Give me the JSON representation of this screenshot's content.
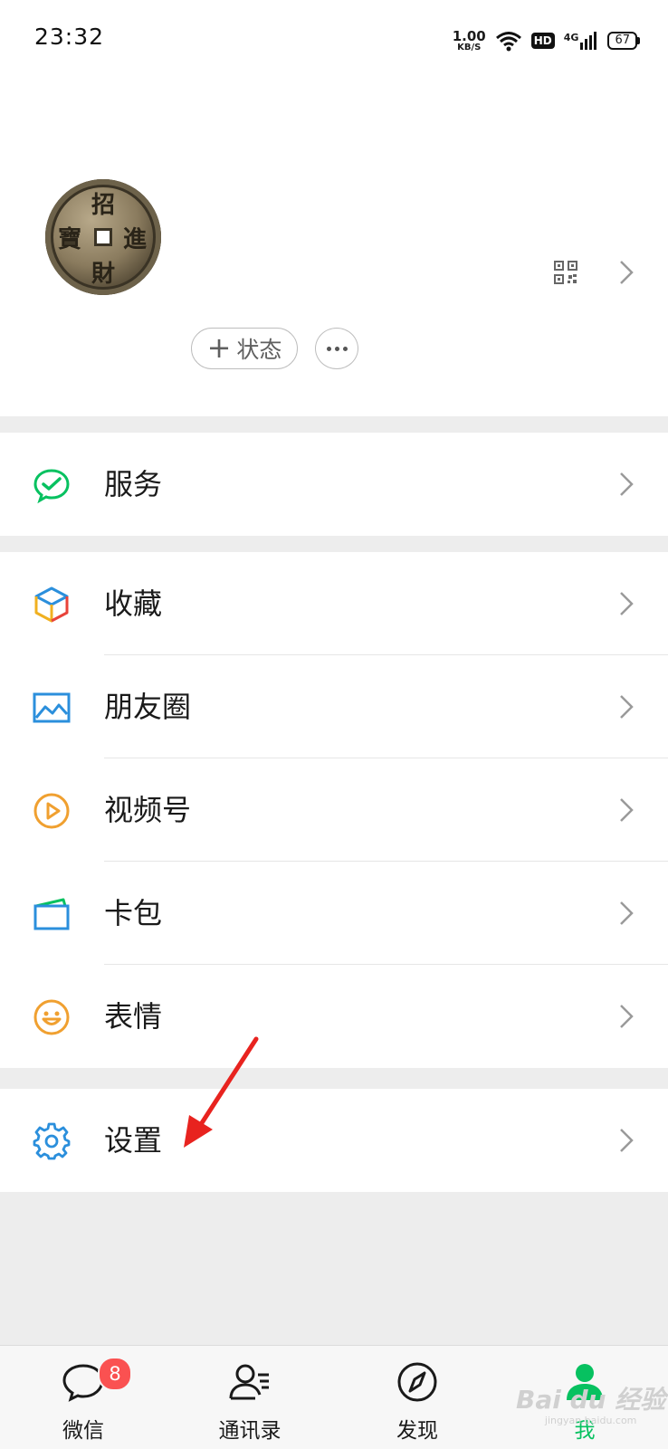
{
  "status_bar": {
    "time": "23:32",
    "net_speed_value": "1.00",
    "net_speed_unit": "KB/S",
    "hd": "HD",
    "network": "4G",
    "battery": "67"
  },
  "profile": {
    "avatar_glyphs": [
      "招",
      "進",
      "財",
      "寶"
    ],
    "status_button_plus": "+",
    "status_button_label": "状态",
    "qr_icon": "qr-code-icon",
    "more_icon": "more-dots-icon"
  },
  "menu": {
    "services": {
      "label": "服务",
      "icon": "services-check-icon",
      "color": "#07c160"
    },
    "favorites": {
      "label": "收藏",
      "icon": "favorites-cube-icon"
    },
    "moments": {
      "label": "朋友圈",
      "icon": "moments-image-icon",
      "color": "#2b8fdc"
    },
    "channels": {
      "label": "视频号",
      "icon": "channels-play-icon",
      "color": "#f0a030"
    },
    "cards": {
      "label": "卡包",
      "icon": "card-wallet-icon",
      "color": "#2b8fdc"
    },
    "stickers": {
      "label": "表情",
      "icon": "smiley-face-icon",
      "color": "#f0a030"
    },
    "settings": {
      "label": "设置",
      "icon": "gear-icon",
      "color": "#2b8fdc"
    }
  },
  "tabbar": {
    "chats": {
      "label": "微信",
      "badge": "8",
      "icon": "chat-bubble-icon"
    },
    "contacts": {
      "label": "通讯录",
      "icon": "contacts-icon"
    },
    "discover": {
      "label": "发现",
      "icon": "compass-icon"
    },
    "me": {
      "label": "我",
      "icon": "person-icon",
      "active": true
    }
  },
  "watermark": {
    "text": "Bai du 经验",
    "sub": "jingyan.baidu.com"
  },
  "colors": {
    "accent": "#07c160",
    "badge": "#fa5151",
    "annotation_arrow": "#e8231f"
  }
}
